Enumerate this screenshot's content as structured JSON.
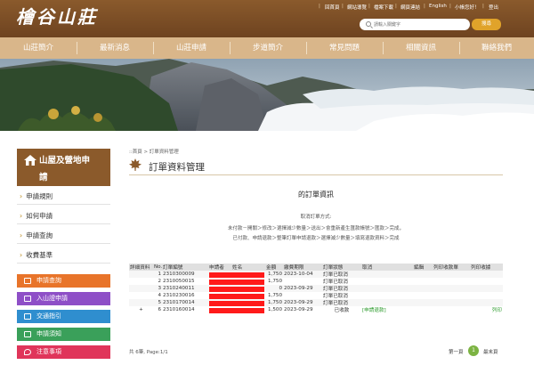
{
  "header": {
    "logo": "檜谷山莊",
    "links": [
      "回首頁",
      "網站導覽",
      "檔案下載",
      "網頁連結",
      "English",
      "小帳您好！",
      "登出"
    ],
    "search_placeholder": "請輸入關鍵字",
    "search_button": "搜尋"
  },
  "nav": {
    "items": [
      "山莊簡介",
      "最新消息",
      "山莊申請",
      "步道簡介",
      "常見問題",
      "相關資訊",
      "聯絡我們"
    ]
  },
  "sidebar": {
    "title_line1": "山屋及營地申",
    "title_line2": "請",
    "links": [
      "申請規則",
      "如何申請",
      "申請查詢",
      "收費基準"
    ],
    "quick_buttons": [
      {
        "label": "申請查詢",
        "color": "#e8742a",
        "icon": "search-doc-icon"
      },
      {
        "label": "入山證申請",
        "color": "#8e4fc7",
        "icon": "permit-icon"
      },
      {
        "label": "交通指引",
        "color": "#2f8ecf",
        "icon": "bus-icon"
      },
      {
        "label": "申請須知",
        "color": "#3aa05a",
        "icon": "notice-icon"
      },
      {
        "label": "注意事項",
        "color": "#e0355a",
        "icon": "pin-icon"
      }
    ]
  },
  "main": {
    "breadcrumb": "::首頁 > 訂單資料管理",
    "title": "訂單資料管理",
    "order_heading": "的訂單資訊",
    "cancel_title": "取消訂單方式:",
    "cancel_lines": [
      "未付款－開關＞修改＞選擇減少數量＞送出＞會重新產生匯款帳號＞匯款＞完成，",
      "已付款、申請退款＞整筆訂單申請退款＞選擇減少數量＞填寫退款資料＞完成"
    ]
  },
  "table": {
    "headers": [
      "詳細資料",
      "No.",
      "訂單編號",
      "申請者",
      "姓名",
      "金額",
      "繳費期限",
      "訂單狀態",
      "取消",
      "編輯",
      "列印收款單",
      "列印收據"
    ],
    "rows": [
      {
        "toggle": "",
        "no": "1",
        "order": "2310300009",
        "amount": "1,750",
        "deadline": "2023-10-04",
        "status": "訂單已取消",
        "cancel": "",
        "print_receipt": ""
      },
      {
        "toggle": "",
        "no": "2",
        "order": "2310050015",
        "amount": "1,750",
        "deadline": "",
        "status": "訂單已取消",
        "cancel": "",
        "print_receipt": ""
      },
      {
        "toggle": "",
        "no": "3",
        "order": "2310240011",
        "amount": "0",
        "deadline": "2023-09-29",
        "status": "訂單已取消",
        "cancel": "",
        "print_receipt": ""
      },
      {
        "toggle": "",
        "no": "4",
        "order": "2310230016",
        "amount": "1,750",
        "deadline": "",
        "status": "訂單已取消",
        "cancel": "",
        "print_receipt": ""
      },
      {
        "toggle": "",
        "no": "5",
        "order": "2310170014",
        "amount": "1,750",
        "deadline": "2023-09-29",
        "status": "訂單已取消",
        "cancel": "",
        "print_receipt": ""
      },
      {
        "toggle": "+",
        "no": "6",
        "order": "2310160014",
        "amount": "1,500",
        "deadline": "2023-09-29",
        "status": "已收款",
        "cancel": "[申請退款]",
        "print_receipt": "列印"
      }
    ]
  },
  "footer": {
    "count_text": "共 6筆, Page:1/1",
    "first_page": "第一頁",
    "current_page": "1",
    "last_page": "最末頁"
  },
  "colors": {
    "brand_brown": "#8b5a2b",
    "nav_tan": "#d9b68a",
    "search_button": "#e0a32a",
    "redaction": "#ff1a1a",
    "page_active": "#7cb342"
  }
}
